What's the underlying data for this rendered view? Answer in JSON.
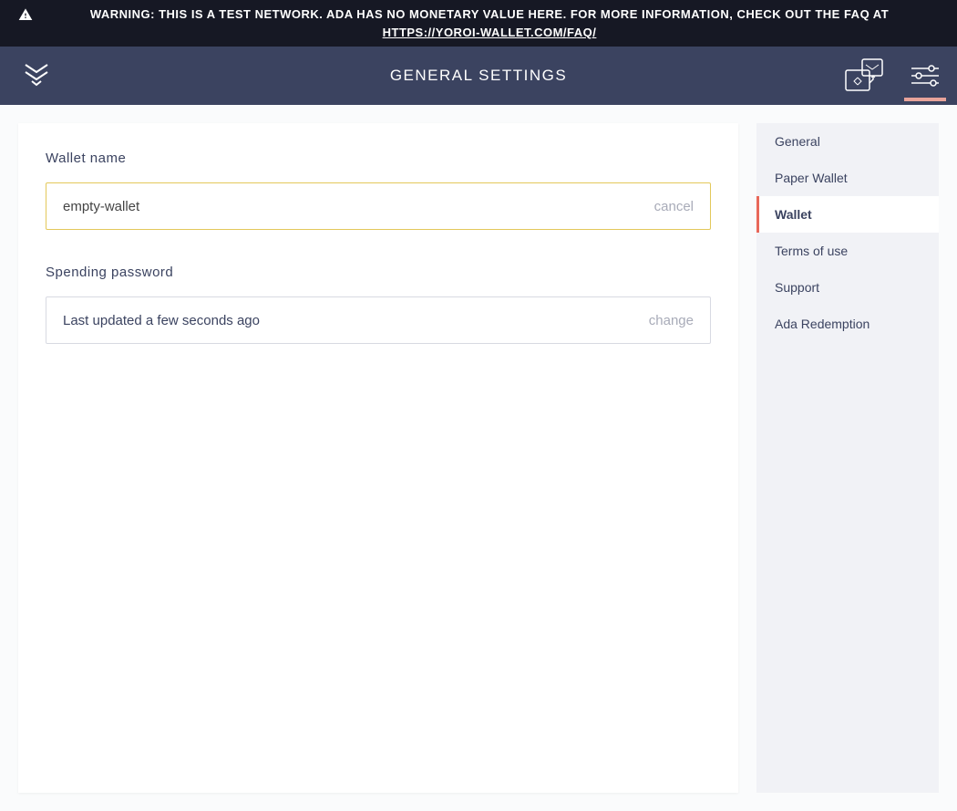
{
  "banner": {
    "text": "WARNING: THIS IS A TEST NETWORK. ADA HAS NO MONETARY VALUE HERE. FOR MORE INFORMATION, CHECK OUT THE FAQ AT ",
    "link_text": "HTTPS://YOROI-WALLET.COM/FAQ/"
  },
  "header": {
    "title": "GENERAL SETTINGS"
  },
  "wallet_name": {
    "label": "Wallet name",
    "value": "empty-wallet",
    "cancel_label": "cancel"
  },
  "spending_password": {
    "label": "Spending password",
    "status": "Last updated a few seconds ago",
    "change_label": "change"
  },
  "sidebar": {
    "items": [
      {
        "label": "General",
        "active": false
      },
      {
        "label": "Paper Wallet",
        "active": false
      },
      {
        "label": "Wallet",
        "active": true
      },
      {
        "label": "Terms of use",
        "active": false
      },
      {
        "label": "Support",
        "active": false
      },
      {
        "label": "Ada Redemption",
        "active": false
      }
    ]
  }
}
